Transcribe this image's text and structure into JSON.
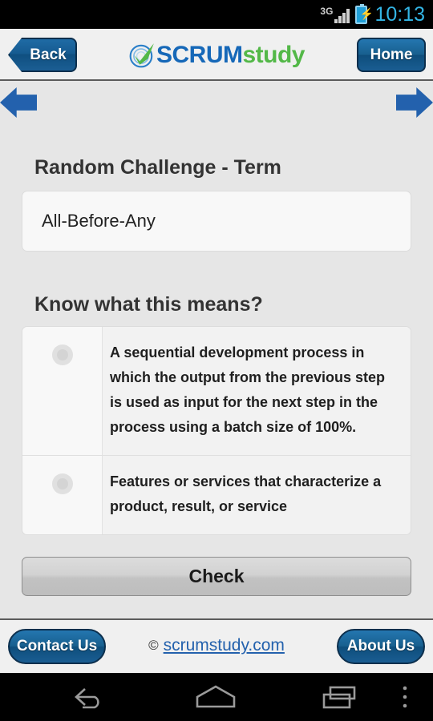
{
  "statusbar": {
    "network_label": "3G",
    "time": "10:13",
    "battery_icon": "battery-charging-icon",
    "signal_icon": "signal-bars-icon"
  },
  "header": {
    "back_label": "Back",
    "home_label": "Home",
    "logo_primary": "SCRUM",
    "logo_secondary": "study",
    "logo_icon": "scrumstudy-check-circle-logo"
  },
  "navbar": {
    "prev_icon": "arrow-left-icon",
    "next_icon": "arrow-right-icon"
  },
  "main": {
    "term_section_title": "Random Challenge - Term",
    "term": "All-Before-Any",
    "question_title": "Know what this means?",
    "options": [
      {
        "text": "A sequential development process in which the output from the previous step is used as input for the next step in the process using a batch size of 100%.",
        "selected": false
      },
      {
        "text": "Features or services that characterize a product, result, or service",
        "selected": false
      }
    ],
    "check_label": "Check"
  },
  "footer": {
    "contact_label": "Contact Us",
    "copyright_symbol": "©",
    "site_link": "scrumstudy.com",
    "about_label": "About Us"
  },
  "androidnav": {
    "back_icon": "android-back-icon",
    "home_icon": "android-home-icon",
    "recents_icon": "android-recents-icon",
    "menu_icon": "android-overflow-menu-icon"
  },
  "colors": {
    "brand_blue": "#1668b8",
    "brand_green": "#53b848",
    "button_blue": "#18608f",
    "arrow_blue": "#2361ad",
    "page_background": "#e6e6e6",
    "status_time": "#33b5e5"
  }
}
